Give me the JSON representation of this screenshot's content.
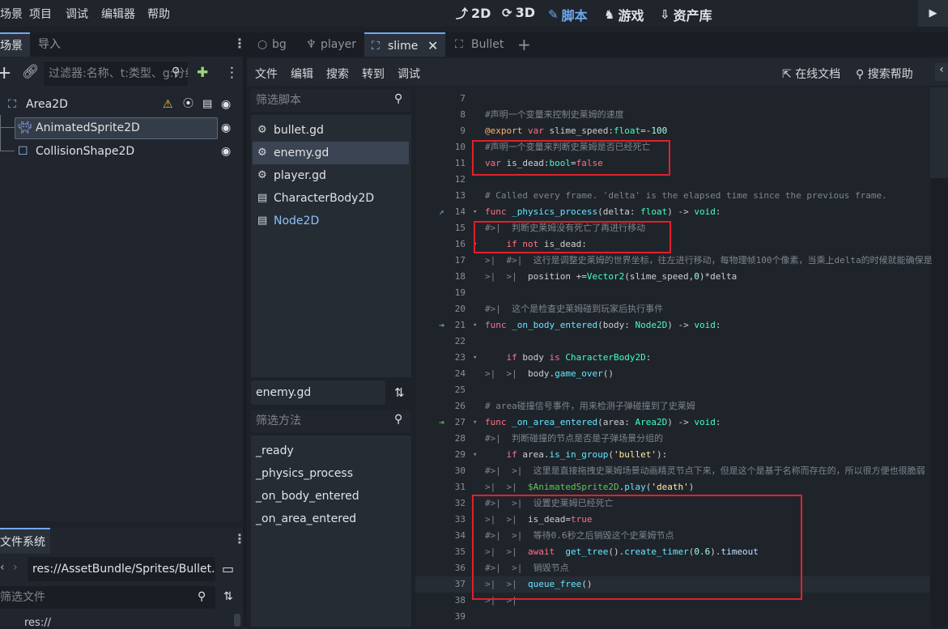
{
  "top_menu": [
    "场景",
    "项目",
    "调试",
    "编辑器",
    "帮助"
  ],
  "workspaces": [
    {
      "icon": "⤴",
      "label": "2D"
    },
    {
      "icon": "⟳",
      "label": "3D"
    },
    {
      "icon": "✎",
      "label": "脚本",
      "active": true
    },
    {
      "icon": "♞",
      "label": "游戏"
    },
    {
      "icon": "⇩",
      "label": "资产库"
    }
  ],
  "play_icon": "▶",
  "scene_dock": {
    "tabs": [
      "场景",
      "导入"
    ],
    "filter_placeholder": "过滤器:名称、t:类型、g:分组",
    "nodes": [
      {
        "name": "Area2D"
      },
      {
        "name": "AnimatedSprite2D",
        "selected": true
      },
      {
        "name": "CollisionShape2D"
      }
    ]
  },
  "fs_dock": {
    "tab": "文件系统",
    "path": "res://AssetBundle/Sprites/Bullet.",
    "filter_placeholder": "筛选文件",
    "root": "res://"
  },
  "script_tabs": [
    {
      "label": "bg"
    },
    {
      "label": "player"
    },
    {
      "label": "slime",
      "active": true
    },
    {
      "label": "Bullet"
    }
  ],
  "script_menu": [
    "文件",
    "编辑",
    "搜索",
    "转到",
    "调试"
  ],
  "script_menu_right": [
    "在线文档",
    "搜索帮助"
  ],
  "script_filter_placeholder": "筛选脚本",
  "scripts": [
    {
      "name": "bullet.gd",
      "icon": "gear-icon"
    },
    {
      "name": "enemy.gd",
      "icon": "gear-icon",
      "selected": true
    },
    {
      "name": "player.gd",
      "icon": "gear-icon"
    },
    {
      "name": "CharacterBody2D",
      "icon": "doc-icon"
    },
    {
      "name": "Node2D",
      "icon": "doc-icon"
    }
  ],
  "current_script": "enemy.gd",
  "method_filter_placeholder": "筛选方法",
  "methods": [
    "_ready",
    "_physics_process",
    "_on_body_entered",
    "_on_area_entered"
  ],
  "code_lines": [
    {
      "n": "7",
      "t": ""
    },
    {
      "n": "8",
      "t": "#声明一个变量来控制史莱姆的速度"
    },
    {
      "n": "9",
      "t": "@export var slime_speed:float=-100"
    },
    {
      "n": "10",
      "t": "#声明一个变量来判断史莱姆是否已经死亡"
    },
    {
      "n": "11",
      "t": "var is_dead:bool=false"
    },
    {
      "n": "12",
      "t": ""
    },
    {
      "n": "13",
      "t": "# Called every frame. 'delta' is the elapsed time since the previous frame."
    },
    {
      "n": "14",
      "t": "func _physics_process(delta: float) -> void:"
    },
    {
      "n": "15",
      "t": "#>|  判断史莱姆没有死亡了再进行移动"
    },
    {
      "n": "16",
      "t": "    if not is_dead:"
    },
    {
      "n": "17",
      "t": ">|  #>|  这行是调整史莱姆的世界坐标，往左进行移动，每物理帧100个像素，当乘上delta的时候就能确保是"
    },
    {
      "n": "18",
      "t": ">|  >|  position +=Vector2(slime_speed,0)*delta"
    },
    {
      "n": "19",
      "t": ""
    },
    {
      "n": "20",
      "t": "#>|  这个是检查史莱姆碰到玩家后执行事件"
    },
    {
      "n": "21",
      "t": "func _on_body_entered(body: Node2D) -> void:"
    },
    {
      "n": "22",
      "t": ""
    },
    {
      "n": "23",
      "t": "    if body is CharacterBody2D:"
    },
    {
      "n": "24",
      "t": ">|  >|  body.game_over()"
    },
    {
      "n": "25",
      "t": ""
    },
    {
      "n": "26",
      "t": "# area碰撞信号事件，用来检测子弹碰撞到了史莱姆"
    },
    {
      "n": "27",
      "t": "func _on_area_entered(area: Area2D) -> void:"
    },
    {
      "n": "28",
      "t": "#>|  判断碰撞的节点是否是子弹场景分组的"
    },
    {
      "n": "29",
      "t": "    if area.is_in_group('bullet'):"
    },
    {
      "n": "30",
      "t": "#>|  >|  这里是直接拖拽史莱姆场景动画精灵节点下来，但是这个是基于名称而存在的，所以很方便也很脆弱"
    },
    {
      "n": "31",
      "t": ">|  >|  $AnimatedSprite2D.play('death')"
    },
    {
      "n": "32",
      "t": "#>|  >|  设置史莱姆已经死亡"
    },
    {
      "n": "33",
      "t": ">|  >|  is_dead=true"
    },
    {
      "n": "34",
      "t": "#>|  >|  等待0.6秒之后销毁这个史莱姆节点"
    },
    {
      "n": "35",
      "t": ">|  >|  await  get_tree().create_timer(0.6).timeout"
    },
    {
      "n": "36",
      "t": "#>|  >|  销毁节点"
    },
    {
      "n": "37",
      "t": ">|  >|  queue_free()"
    },
    {
      "n": "38",
      "t": ">|  >|"
    },
    {
      "n": "39",
      "t": ""
    }
  ]
}
